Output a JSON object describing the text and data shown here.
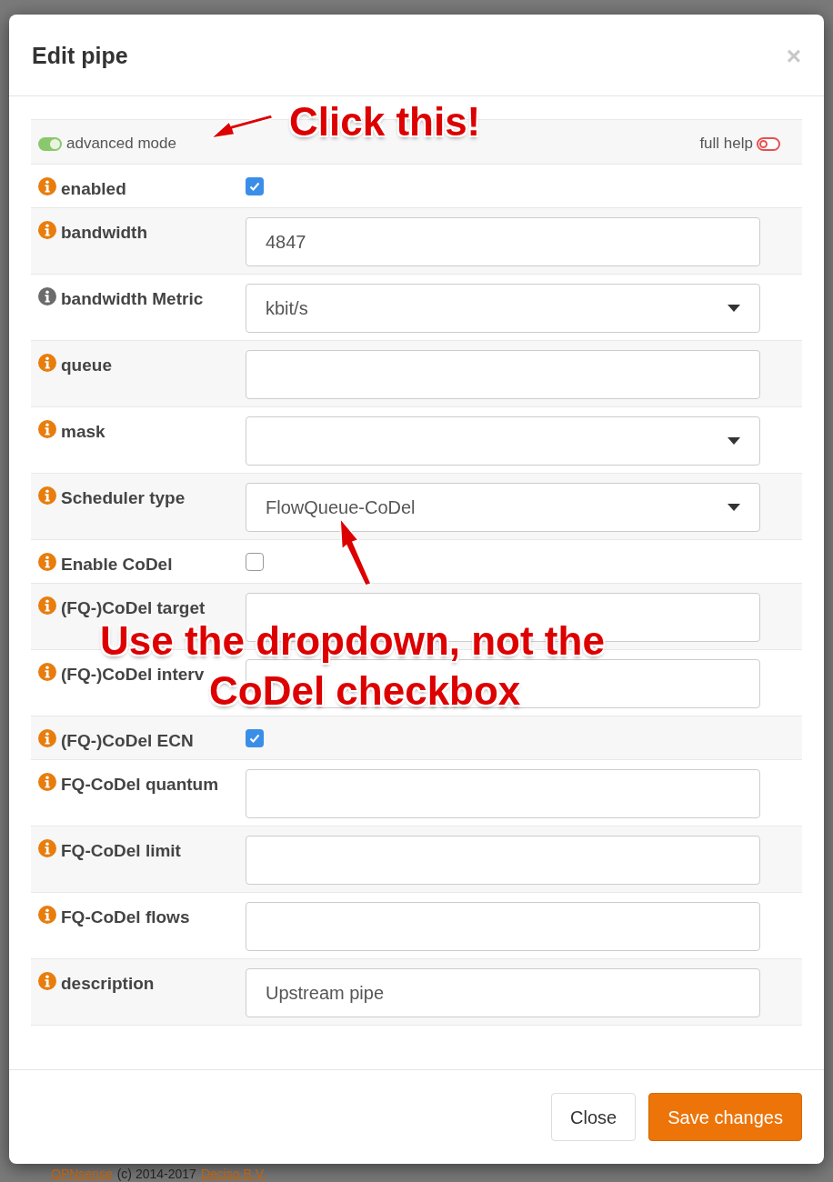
{
  "modal": {
    "title": "Edit pipe",
    "close": "×"
  },
  "mode_bar": {
    "advanced": {
      "label": "advanced mode",
      "on": true
    },
    "help": {
      "label": "full help",
      "on": false
    }
  },
  "rows": [
    {
      "kind": "checkbox",
      "label": "enabled",
      "color": "#e87d0d",
      "checked": true
    },
    {
      "kind": "text",
      "label": "bandwidth",
      "color": "#e87d0d",
      "value": "4847"
    },
    {
      "kind": "select",
      "label": "bandwidth Metric",
      "color": "#6b6b6b",
      "value": "kbit/s"
    },
    {
      "kind": "text",
      "label": "queue",
      "color": "#e87d0d",
      "value": ""
    },
    {
      "kind": "select",
      "label": "mask",
      "color": "#e87d0d",
      "value": ""
    },
    {
      "kind": "select",
      "label": "Scheduler type",
      "color": "#e87d0d",
      "value": "FlowQueue-CoDel"
    },
    {
      "kind": "checkbox",
      "label": "Enable CoDel",
      "color": "#e87d0d",
      "checked": false
    },
    {
      "kind": "text",
      "label": "(FQ-)CoDel target",
      "color": "#e87d0d",
      "value": ""
    },
    {
      "kind": "text",
      "label": "(FQ-)CoDel interv",
      "color": "#e87d0d",
      "value": ""
    },
    {
      "kind": "checkbox",
      "label": "(FQ-)CoDel ECN",
      "color": "#e87d0d",
      "checked": true
    },
    {
      "kind": "text",
      "label": "FQ-CoDel quantum",
      "color": "#e87d0d",
      "value": ""
    },
    {
      "kind": "text",
      "label": "FQ-CoDel limit",
      "color": "#e87d0d",
      "value": ""
    },
    {
      "kind": "text",
      "label": "FQ-CoDel flows",
      "color": "#e87d0d",
      "value": ""
    },
    {
      "kind": "text",
      "label": "description",
      "color": "#e87d0d",
      "value": "Upstream pipe"
    }
  ],
  "buttons": [
    {
      "label": "Close",
      "kind": "default"
    },
    {
      "label": "Save changes",
      "kind": "primary"
    }
  ],
  "annotations": [
    {
      "text": "Click this!"
    },
    {
      "text": "Use the dropdown, not the"
    },
    {
      "text": "CoDel checkbox"
    }
  ],
  "page_footer": {
    "brand": "OPNsense",
    "copyright": "(c) 2014-2017",
    "company": "Deciso B.V."
  }
}
